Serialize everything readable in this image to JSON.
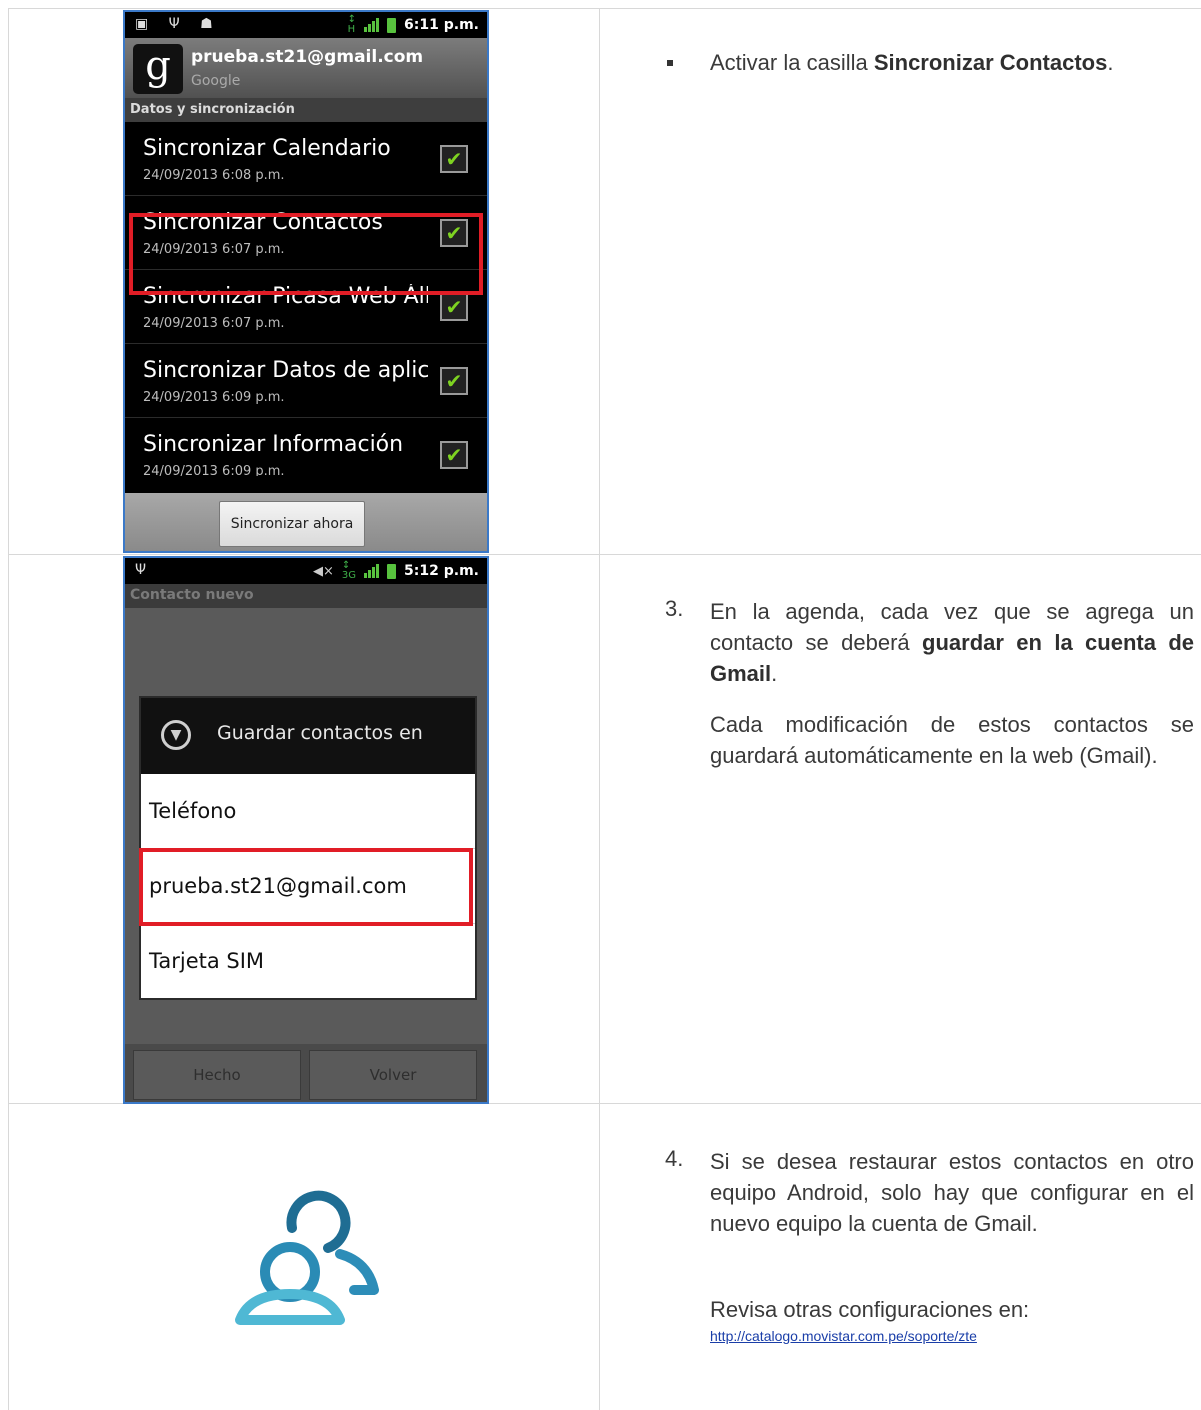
{
  "phone1": {
    "status_time": "6:11 p.m.",
    "account_email": "prueba.st21@gmail.com",
    "account_type": "Google",
    "account_logo": "g",
    "section_header": "Datos y sincronización",
    "items": [
      {
        "title": "Sincronizar Calendario",
        "date": "24/09/2013 6:08 p.m."
      },
      {
        "title": "Sincronizar Contactos",
        "date": "24/09/2013 6:07 p.m."
      },
      {
        "title": "Sincronizar Picasa Web Álbumes",
        "date": "24/09/2013 6:07 p.m."
      },
      {
        "title": "Sincronizar Datos de aplicaciones",
        "date": "24/09/2013 6:09 p.m."
      },
      {
        "title": "Sincronizar Información",
        "date": "24/09/2013 6:09 p.m."
      }
    ],
    "sync_button": "Sincronizar ahora"
  },
  "phone2": {
    "status_time": "5:12 p.m.",
    "title": "Contacto nuevo",
    "dialog_title": "Guardar contactos en",
    "options": [
      "Teléfono",
      "prueba.st21@gmail.com",
      "Tarjeta SIM"
    ],
    "done_button": "Hecho",
    "back_button": "Volver"
  },
  "steps": {
    "bullet_pre": "Activar la casilla ",
    "bullet_bold": "Sincronizar Contactos",
    "bullet_post": ".",
    "step3_num": "3.",
    "step3_pre": "En la agenda, cada vez que se agrega un contacto se deberá ",
    "step3_bold": "guardar en la cuenta de Gmail",
    "step3_post": ".",
    "step3_note": "Cada modificación de estos contactos se guardará automáticamente en la web (Gmail).",
    "step4_num": "4.",
    "step4_text": "Si se desea restaurar estos  contactos en otro equipo Android, solo hay que configurar en el nuevo equipo  la cuenta de Gmail.",
    "more_label": "Revisa otras configuraciones en:",
    "more_link": "http://catalogo.movistar.com.pe/soporte/zte"
  },
  "colors": {
    "highlight": "#e11d26",
    "check": "#7ed321",
    "contacts_icon_dark": "#1f6d93",
    "contacts_icon_light": "#4fb8d4",
    "link": "#1a3ea8"
  }
}
